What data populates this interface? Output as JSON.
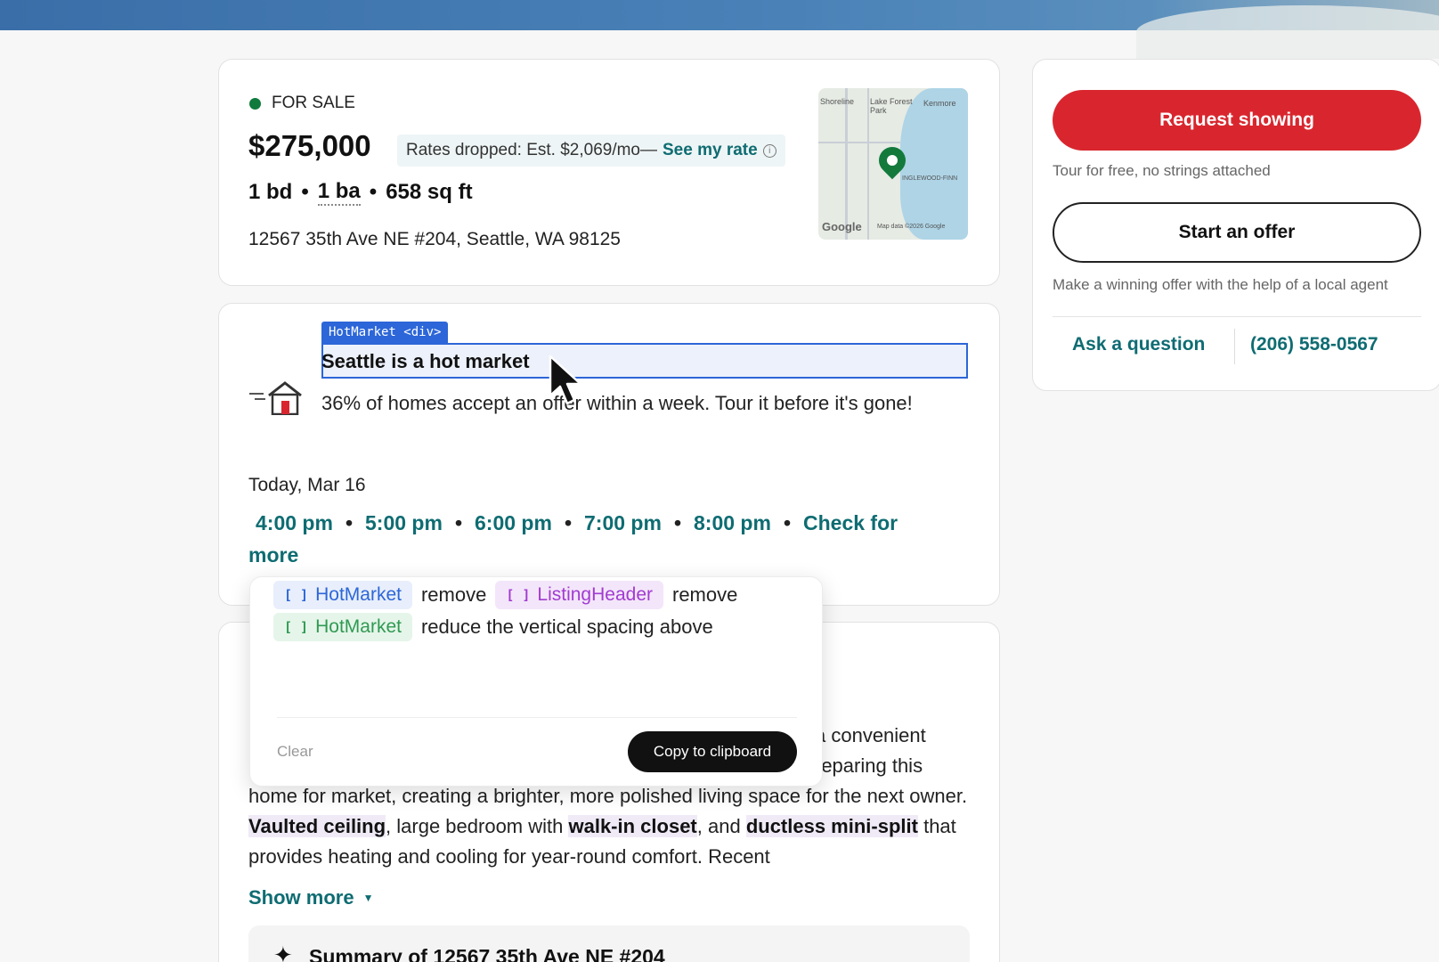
{
  "listing": {
    "status": "FOR SALE",
    "price": "$275,000",
    "rate_text": "Rates dropped: Est. $2,069/mo—",
    "rate_link": "See my rate",
    "beds": "1 bd",
    "baths": "1 ba",
    "sqft": "658 sq ft",
    "address": "12567 35th Ave NE #204, Seattle, WA 98125",
    "map": {
      "labels": [
        "Shoreline",
        "Lake Forest Park",
        "Kenmore",
        "INGLEWOOD-FINN",
        "Map data ©2026 Google",
        "Google"
      ]
    }
  },
  "hot_market": {
    "inspector_tag": "HotMarket <div>",
    "title": "Seattle is a hot market",
    "description": "36% of homes accept an offer within a week. Tour it before it's gone!",
    "date": "Today, Mar 16",
    "times": [
      "4:00 pm",
      "5:00 pm",
      "6:00 pm",
      "7:00 pm",
      "8:00 pm"
    ],
    "check_more": "Check for more"
  },
  "overlay": {
    "row1": {
      "chip1": "HotMarket",
      "action1": "remove",
      "chip2": "ListingHeader",
      "action2": "remove"
    },
    "row2": {
      "chip": "HotMarket",
      "action": "reduce the vertical spacing above"
    },
    "clear_label": "Clear",
    "copy_label": "Copy to clipboard"
  },
  "description": {
    "frag1": "a convenient",
    "frag2": "reparing this",
    "line3": "home for market, creating a brighter, more polished living space for the next owner. ",
    "hl1": "Vaulted ceiling",
    "t2": ", large bedroom with ",
    "hl2": "walk-in closet",
    "t3": ", and ",
    "hl3": "ductless mini-split",
    "t4": " that provides heating and cooling for year-round comfort. Recent",
    "show_more": "Show more",
    "summary_title": "Summary of 12567 35th Ave NE #204"
  },
  "sidebar": {
    "request_label": "Request showing",
    "request_note": "Tour for free, no strings attached",
    "offer_label": "Start an offer",
    "offer_note": "Make a winning offer with the help of a local agent",
    "ask_label": "Ask a question",
    "phone": "(206) 558-0567"
  },
  "colors": {
    "accent_teal": "#0e6c72",
    "request_red": "#d9262e",
    "status_green": "#0f7a3c",
    "inspector_blue": "#2c66d8"
  }
}
